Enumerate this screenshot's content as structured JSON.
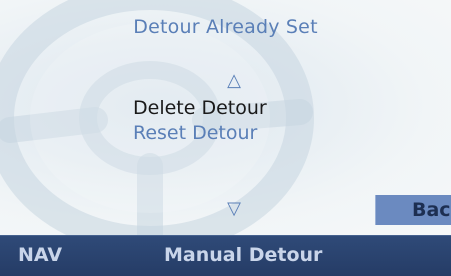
{
  "screen": {
    "title": "Detour Already Set",
    "scroll_up_icon": "triangle-up-icon",
    "scroll_down_icon": "triangle-down-icon"
  },
  "menu": {
    "items": [
      {
        "label": "Delete Detour",
        "selected": true
      },
      {
        "label": "Reset Detour",
        "selected": false
      }
    ]
  },
  "back_button": {
    "label": "Back"
  },
  "bottom_bar": {
    "mode": "NAV",
    "status": "Manual Detour"
  },
  "colors": {
    "accent_text": "#5a7fb7",
    "selected_text": "#1a1a1a",
    "bar_background": "#2b4471",
    "button_background": "#6b8ac0"
  }
}
